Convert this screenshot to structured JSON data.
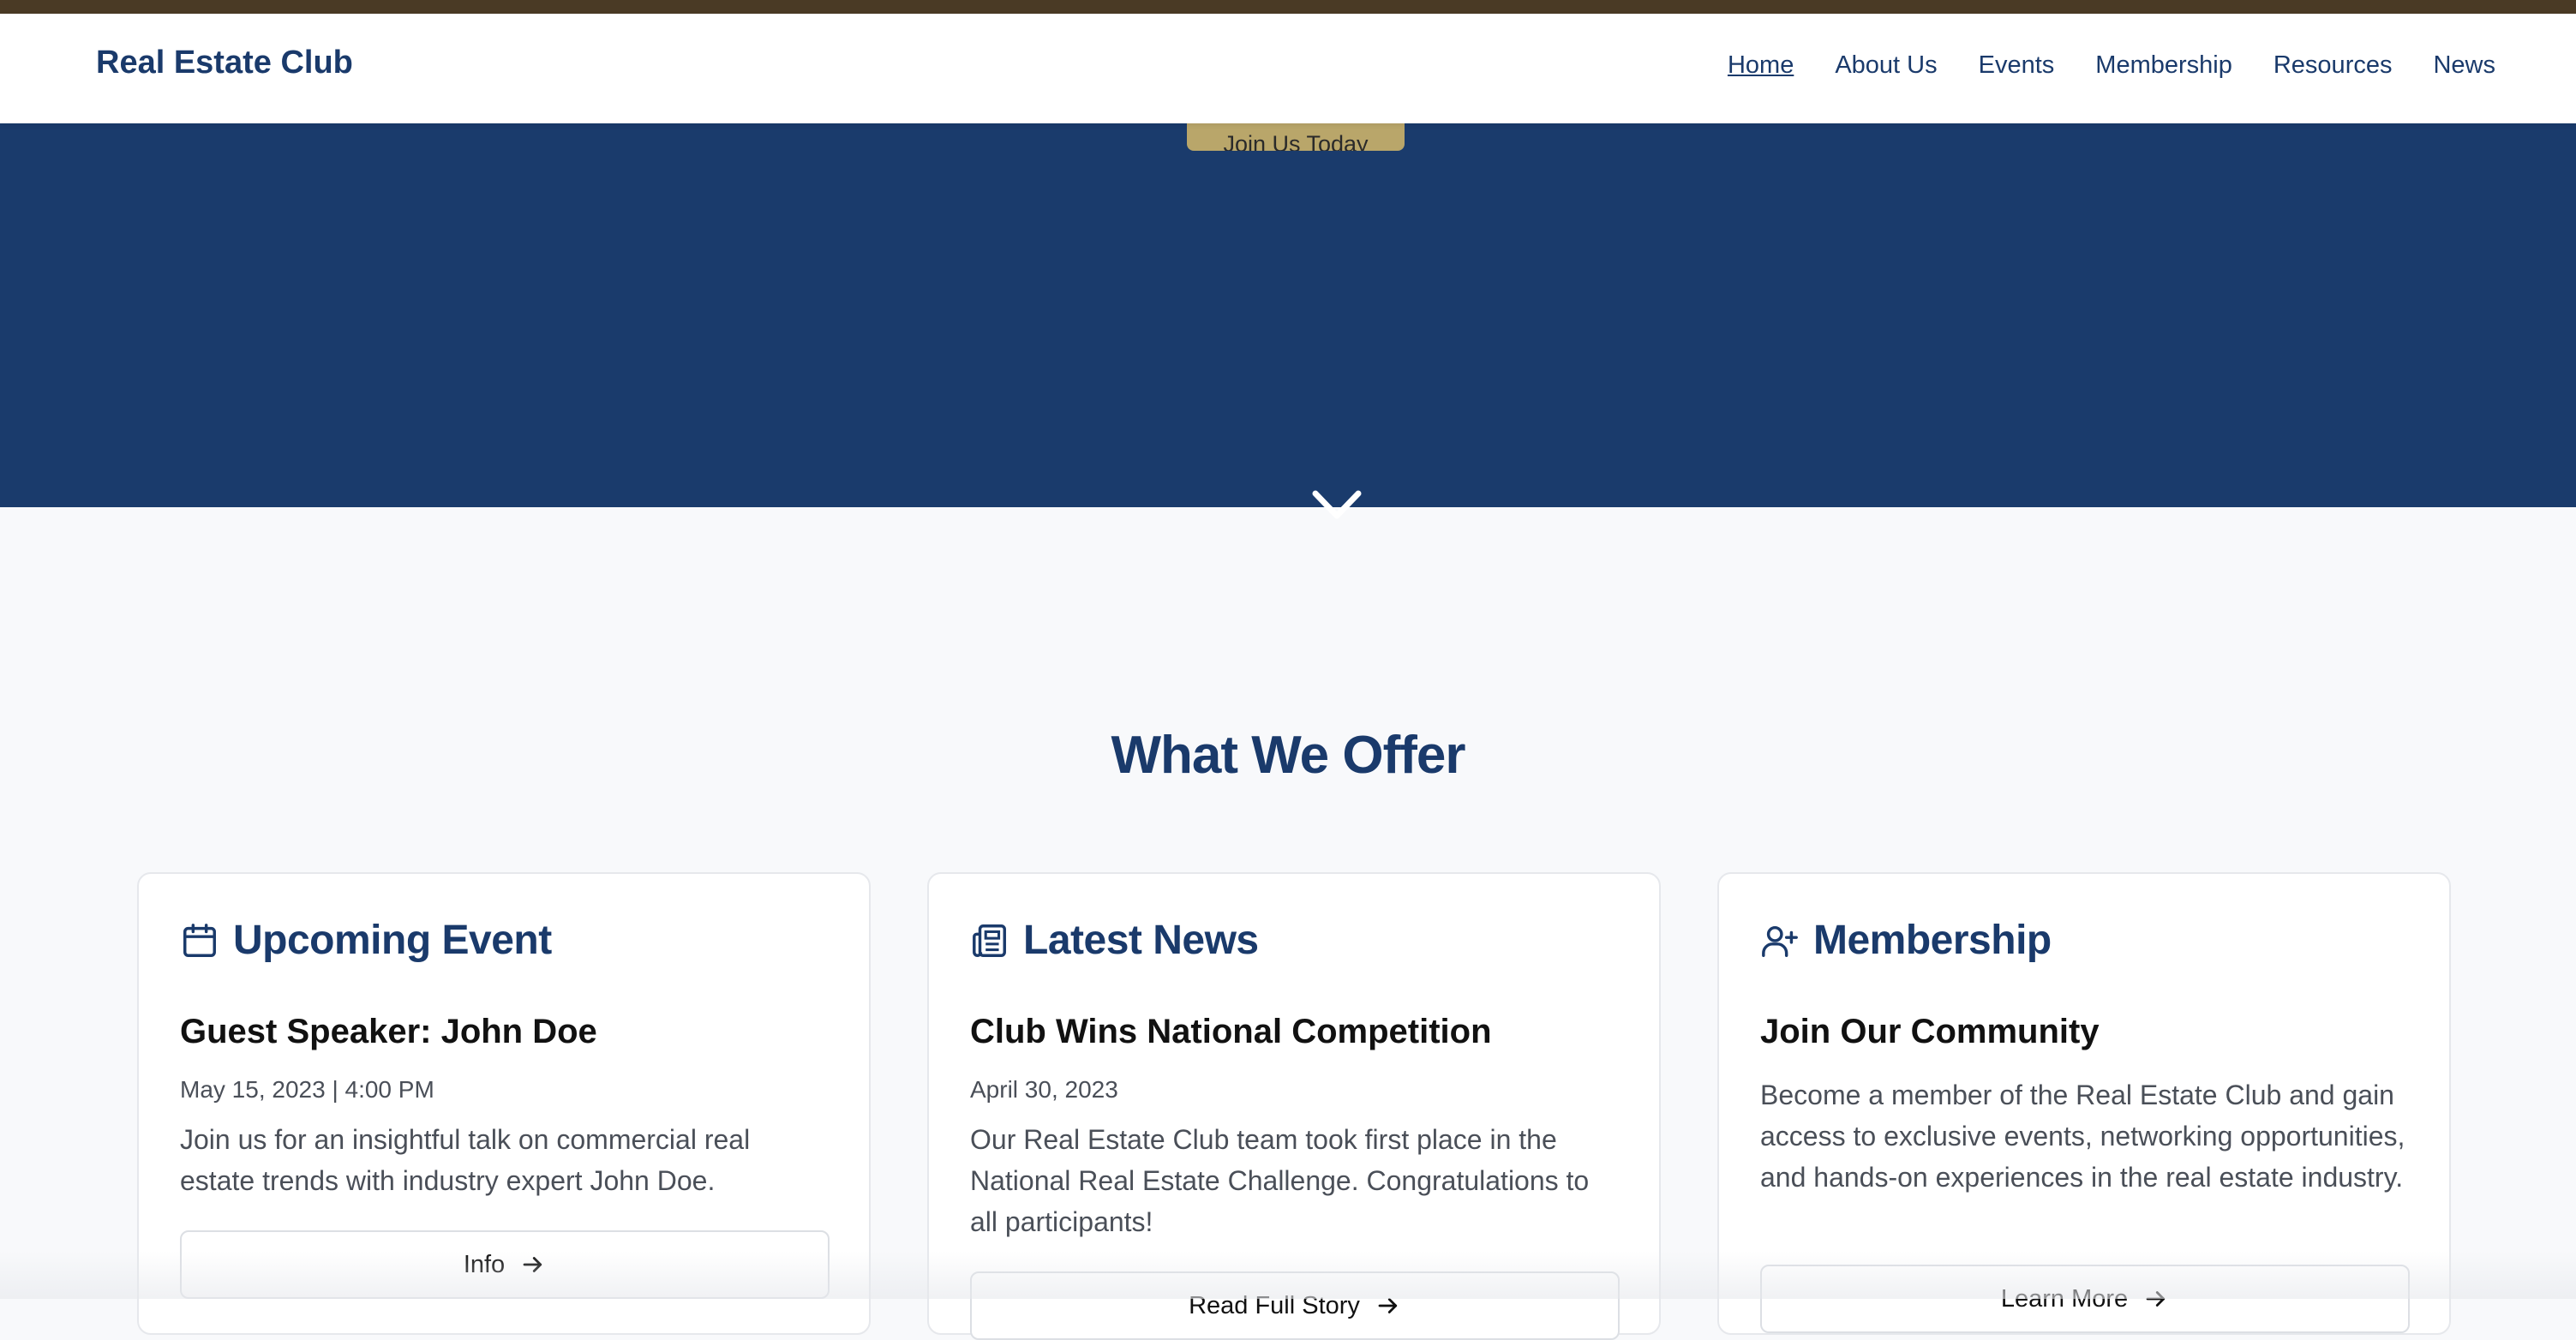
{
  "colors": {
    "brand": "#1a3a6b",
    "hero_bg": "#1a3b6c",
    "accent_gold": "#b9a66a",
    "top_strip": "#4a3a25"
  },
  "header": {
    "brand": "Real Estate Club",
    "nav": [
      {
        "label": "Home",
        "active": true
      },
      {
        "label": "About Us"
      },
      {
        "label": "Events"
      },
      {
        "label": "Membership"
      },
      {
        "label": "Resources"
      },
      {
        "label": "News"
      }
    ]
  },
  "hero": {
    "cta_label": "Join Us Today",
    "scroll_icon": "chevron-down-icon"
  },
  "offer": {
    "title": "What We Offer",
    "cards": [
      {
        "icon": "calendar-icon",
        "title": "Upcoming Event",
        "subtitle": "Guest Speaker: John Doe",
        "date": "May 15, 2023 | 4:00 PM",
        "description": "Join us for an insightful talk on commercial real estate trends with industry expert John Doe.",
        "button_label": "Info"
      },
      {
        "icon": "newspaper-icon",
        "title": "Latest News",
        "subtitle": "Club Wins National Competition",
        "date": "April 30, 2023",
        "description": "Our Real Estate Club team took first place in the National Real Estate Challenge. Congratulations to all participants!",
        "button_label": "Read Full Story"
      },
      {
        "icon": "user-plus-icon",
        "title": "Membership",
        "subtitle": "Join Our Community",
        "description": "Become a member of the Real Estate Club and gain access to exclusive events, networking opportunities, and hands-on experiences in the real estate industry.",
        "button_label": "Learn More"
      }
    ]
  }
}
